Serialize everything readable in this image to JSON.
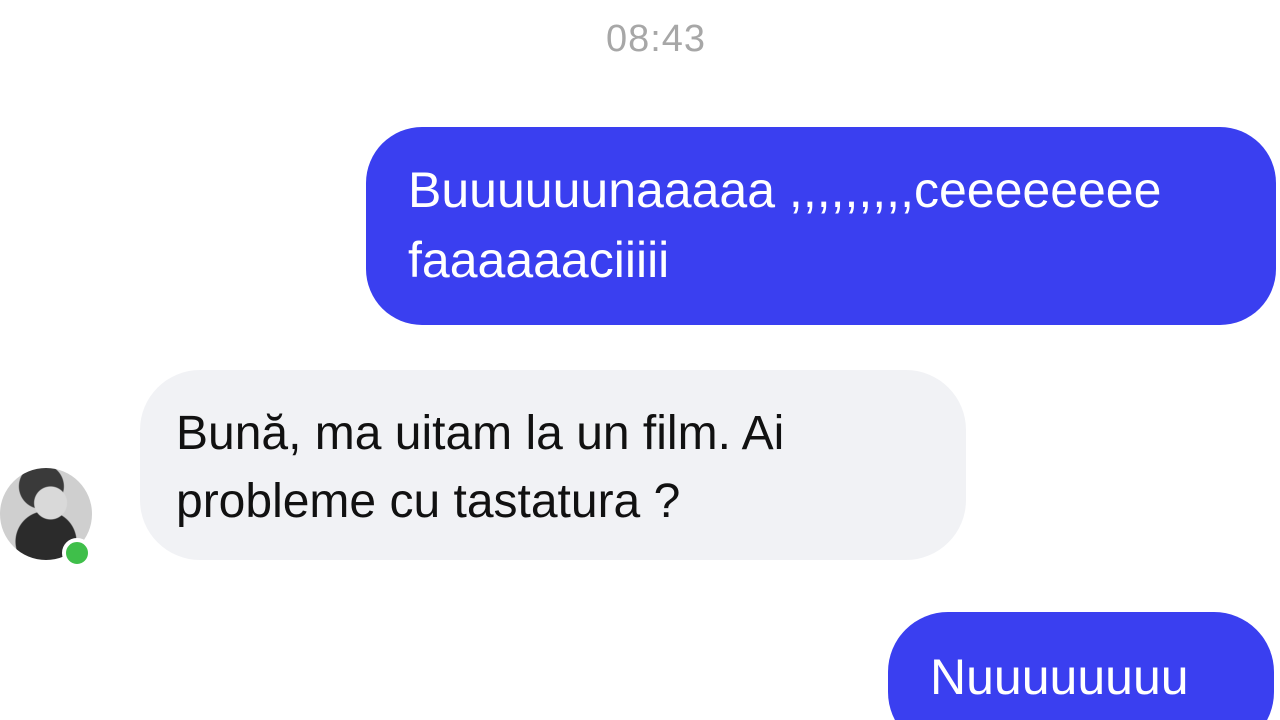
{
  "chat": {
    "timestamp": "08:43",
    "messages": [
      {
        "direction": "sent",
        "text": "Buuuuuunaaaaa ,,,,,,,,,ceeeeeeee faaaaaaciiiii"
      },
      {
        "direction": "received",
        "text": "Bună, ma uitam la un film. Ai probleme cu tastatura ?"
      },
      {
        "direction": "sent",
        "text": "Nuuuuuuuu"
      }
    ],
    "contact": {
      "avatar_icon": "avatar-photo",
      "online_status": "online"
    }
  },
  "colors": {
    "sent_bubble": "#3a3ff0",
    "received_bubble": "#f1f2f5",
    "timestamp_text": "#a7a7a7",
    "online_indicator": "#3fbf4a"
  }
}
